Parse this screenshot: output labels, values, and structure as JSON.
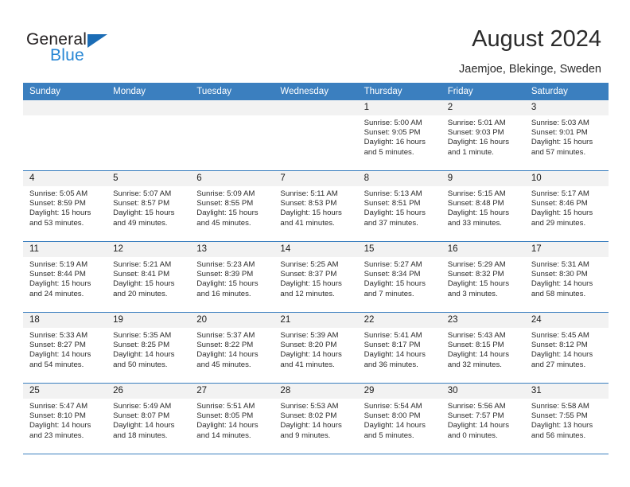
{
  "brand": {
    "word1": "General",
    "word2": "Blue",
    "triangle_icon": "triangle-icon",
    "accent_color": "#2786d4",
    "dark_color": "#231f20"
  },
  "header": {
    "title": "August 2024",
    "subtitle": "Jaemjoe, Blekinge, Sweden"
  },
  "calendar": {
    "header_bg": "#3b7fbf",
    "daynum_bg": "#f2f2f2",
    "weekdays": [
      "Sunday",
      "Monday",
      "Tuesday",
      "Wednesday",
      "Thursday",
      "Friday",
      "Saturday"
    ],
    "weeks": [
      [
        {
          "day": "",
          "lines": []
        },
        {
          "day": "",
          "lines": []
        },
        {
          "day": "",
          "lines": []
        },
        {
          "day": "",
          "lines": []
        },
        {
          "day": "1",
          "lines": [
            "Sunrise: 5:00 AM",
            "Sunset: 9:05 PM",
            "Daylight: 16 hours and 5 minutes."
          ]
        },
        {
          "day": "2",
          "lines": [
            "Sunrise: 5:01 AM",
            "Sunset: 9:03 PM",
            "Daylight: 16 hours and 1 minute."
          ]
        },
        {
          "day": "3",
          "lines": [
            "Sunrise: 5:03 AM",
            "Sunset: 9:01 PM",
            "Daylight: 15 hours and 57 minutes."
          ]
        }
      ],
      [
        {
          "day": "4",
          "lines": [
            "Sunrise: 5:05 AM",
            "Sunset: 8:59 PM",
            "Daylight: 15 hours and 53 minutes."
          ]
        },
        {
          "day": "5",
          "lines": [
            "Sunrise: 5:07 AM",
            "Sunset: 8:57 PM",
            "Daylight: 15 hours and 49 minutes."
          ]
        },
        {
          "day": "6",
          "lines": [
            "Sunrise: 5:09 AM",
            "Sunset: 8:55 PM",
            "Daylight: 15 hours and 45 minutes."
          ]
        },
        {
          "day": "7",
          "lines": [
            "Sunrise: 5:11 AM",
            "Sunset: 8:53 PM",
            "Daylight: 15 hours and 41 minutes."
          ]
        },
        {
          "day": "8",
          "lines": [
            "Sunrise: 5:13 AM",
            "Sunset: 8:51 PM",
            "Daylight: 15 hours and 37 minutes."
          ]
        },
        {
          "day": "9",
          "lines": [
            "Sunrise: 5:15 AM",
            "Sunset: 8:48 PM",
            "Daylight: 15 hours and 33 minutes."
          ]
        },
        {
          "day": "10",
          "lines": [
            "Sunrise: 5:17 AM",
            "Sunset: 8:46 PM",
            "Daylight: 15 hours and 29 minutes."
          ]
        }
      ],
      [
        {
          "day": "11",
          "lines": [
            "Sunrise: 5:19 AM",
            "Sunset: 8:44 PM",
            "Daylight: 15 hours and 24 minutes."
          ]
        },
        {
          "day": "12",
          "lines": [
            "Sunrise: 5:21 AM",
            "Sunset: 8:41 PM",
            "Daylight: 15 hours and 20 minutes."
          ]
        },
        {
          "day": "13",
          "lines": [
            "Sunrise: 5:23 AM",
            "Sunset: 8:39 PM",
            "Daylight: 15 hours and 16 minutes."
          ]
        },
        {
          "day": "14",
          "lines": [
            "Sunrise: 5:25 AM",
            "Sunset: 8:37 PM",
            "Daylight: 15 hours and 12 minutes."
          ]
        },
        {
          "day": "15",
          "lines": [
            "Sunrise: 5:27 AM",
            "Sunset: 8:34 PM",
            "Daylight: 15 hours and 7 minutes."
          ]
        },
        {
          "day": "16",
          "lines": [
            "Sunrise: 5:29 AM",
            "Sunset: 8:32 PM",
            "Daylight: 15 hours and 3 minutes."
          ]
        },
        {
          "day": "17",
          "lines": [
            "Sunrise: 5:31 AM",
            "Sunset: 8:30 PM",
            "Daylight: 14 hours and 58 minutes."
          ]
        }
      ],
      [
        {
          "day": "18",
          "lines": [
            "Sunrise: 5:33 AM",
            "Sunset: 8:27 PM",
            "Daylight: 14 hours and 54 minutes."
          ]
        },
        {
          "day": "19",
          "lines": [
            "Sunrise: 5:35 AM",
            "Sunset: 8:25 PM",
            "Daylight: 14 hours and 50 minutes."
          ]
        },
        {
          "day": "20",
          "lines": [
            "Sunrise: 5:37 AM",
            "Sunset: 8:22 PM",
            "Daylight: 14 hours and 45 minutes."
          ]
        },
        {
          "day": "21",
          "lines": [
            "Sunrise: 5:39 AM",
            "Sunset: 8:20 PM",
            "Daylight: 14 hours and 41 minutes."
          ]
        },
        {
          "day": "22",
          "lines": [
            "Sunrise: 5:41 AM",
            "Sunset: 8:17 PM",
            "Daylight: 14 hours and 36 minutes."
          ]
        },
        {
          "day": "23",
          "lines": [
            "Sunrise: 5:43 AM",
            "Sunset: 8:15 PM",
            "Daylight: 14 hours and 32 minutes."
          ]
        },
        {
          "day": "24",
          "lines": [
            "Sunrise: 5:45 AM",
            "Sunset: 8:12 PM",
            "Daylight: 14 hours and 27 minutes."
          ]
        }
      ],
      [
        {
          "day": "25",
          "lines": [
            "Sunrise: 5:47 AM",
            "Sunset: 8:10 PM",
            "Daylight: 14 hours and 23 minutes."
          ]
        },
        {
          "day": "26",
          "lines": [
            "Sunrise: 5:49 AM",
            "Sunset: 8:07 PM",
            "Daylight: 14 hours and 18 minutes."
          ]
        },
        {
          "day": "27",
          "lines": [
            "Sunrise: 5:51 AM",
            "Sunset: 8:05 PM",
            "Daylight: 14 hours and 14 minutes."
          ]
        },
        {
          "day": "28",
          "lines": [
            "Sunrise: 5:53 AM",
            "Sunset: 8:02 PM",
            "Daylight: 14 hours and 9 minutes."
          ]
        },
        {
          "day": "29",
          "lines": [
            "Sunrise: 5:54 AM",
            "Sunset: 8:00 PM",
            "Daylight: 14 hours and 5 minutes."
          ]
        },
        {
          "day": "30",
          "lines": [
            "Sunrise: 5:56 AM",
            "Sunset: 7:57 PM",
            "Daylight: 14 hours and 0 minutes."
          ]
        },
        {
          "day": "31",
          "lines": [
            "Sunrise: 5:58 AM",
            "Sunset: 7:55 PM",
            "Daylight: 13 hours and 56 minutes."
          ]
        }
      ]
    ]
  }
}
